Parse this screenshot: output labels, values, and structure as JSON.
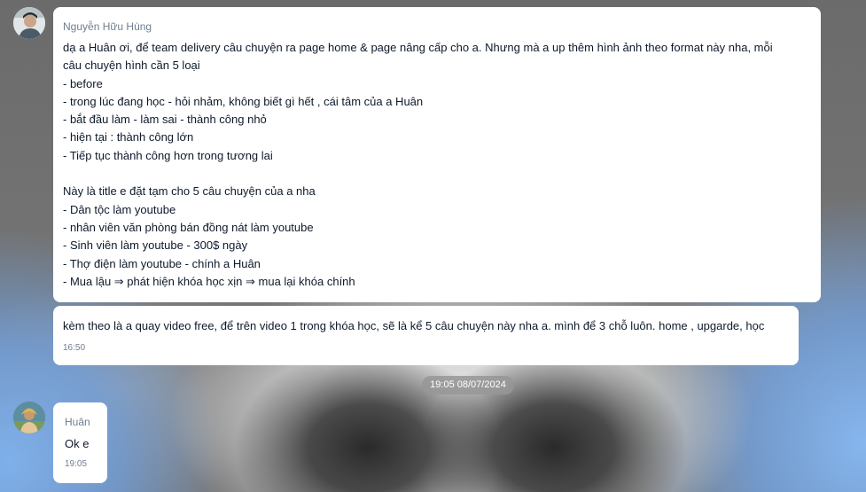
{
  "messages": [
    {
      "sender": "Nguyễn Hữu Hùng",
      "lines": [
        "dạ a Huân ơi, để team delivery câu chuyện ra page home & page nâng cấp cho a. Nhưng mà a up thêm hình ảnh theo format này nha, mỗi",
        "câu chuyện hình cần 5 loại",
        "- before",
        "- trong lúc đang học - hỏi nhảm, không biết gì hết , cái tâm của a Huân",
        "- bắt đầu làm - làm sai - thành công nhỏ",
        "- hiện tại : thành công lớn",
        "- Tiếp tục thành công hơn trong tương lai",
        "",
        "Này là title e đặt tạm cho 5 câu chuyện của a nha",
        "- Dân tộc làm youtube",
        "- nhân viên văn phòng bán đồng nát làm youtube",
        "- Sinh viên làm youtube - 300$ ngày",
        "- Thợ điện làm youtube - chính a Huân",
        "- Mua lậu ⇒ phát hiện khóa học xịn ⇒ mua lại khóa chính"
      ]
    },
    {
      "text": "kèm theo là a quay video free, để trên video 1 trong khóa học, sẽ là kể 5 câu chuyện này nha a. mình để 3 chỗ luôn. home , upgarde, học",
      "time": "16:50"
    },
    {
      "sender": "Huân",
      "text": "Ok e",
      "time": "19:05"
    }
  ],
  "date_separator": "19:05 08/07/2024"
}
